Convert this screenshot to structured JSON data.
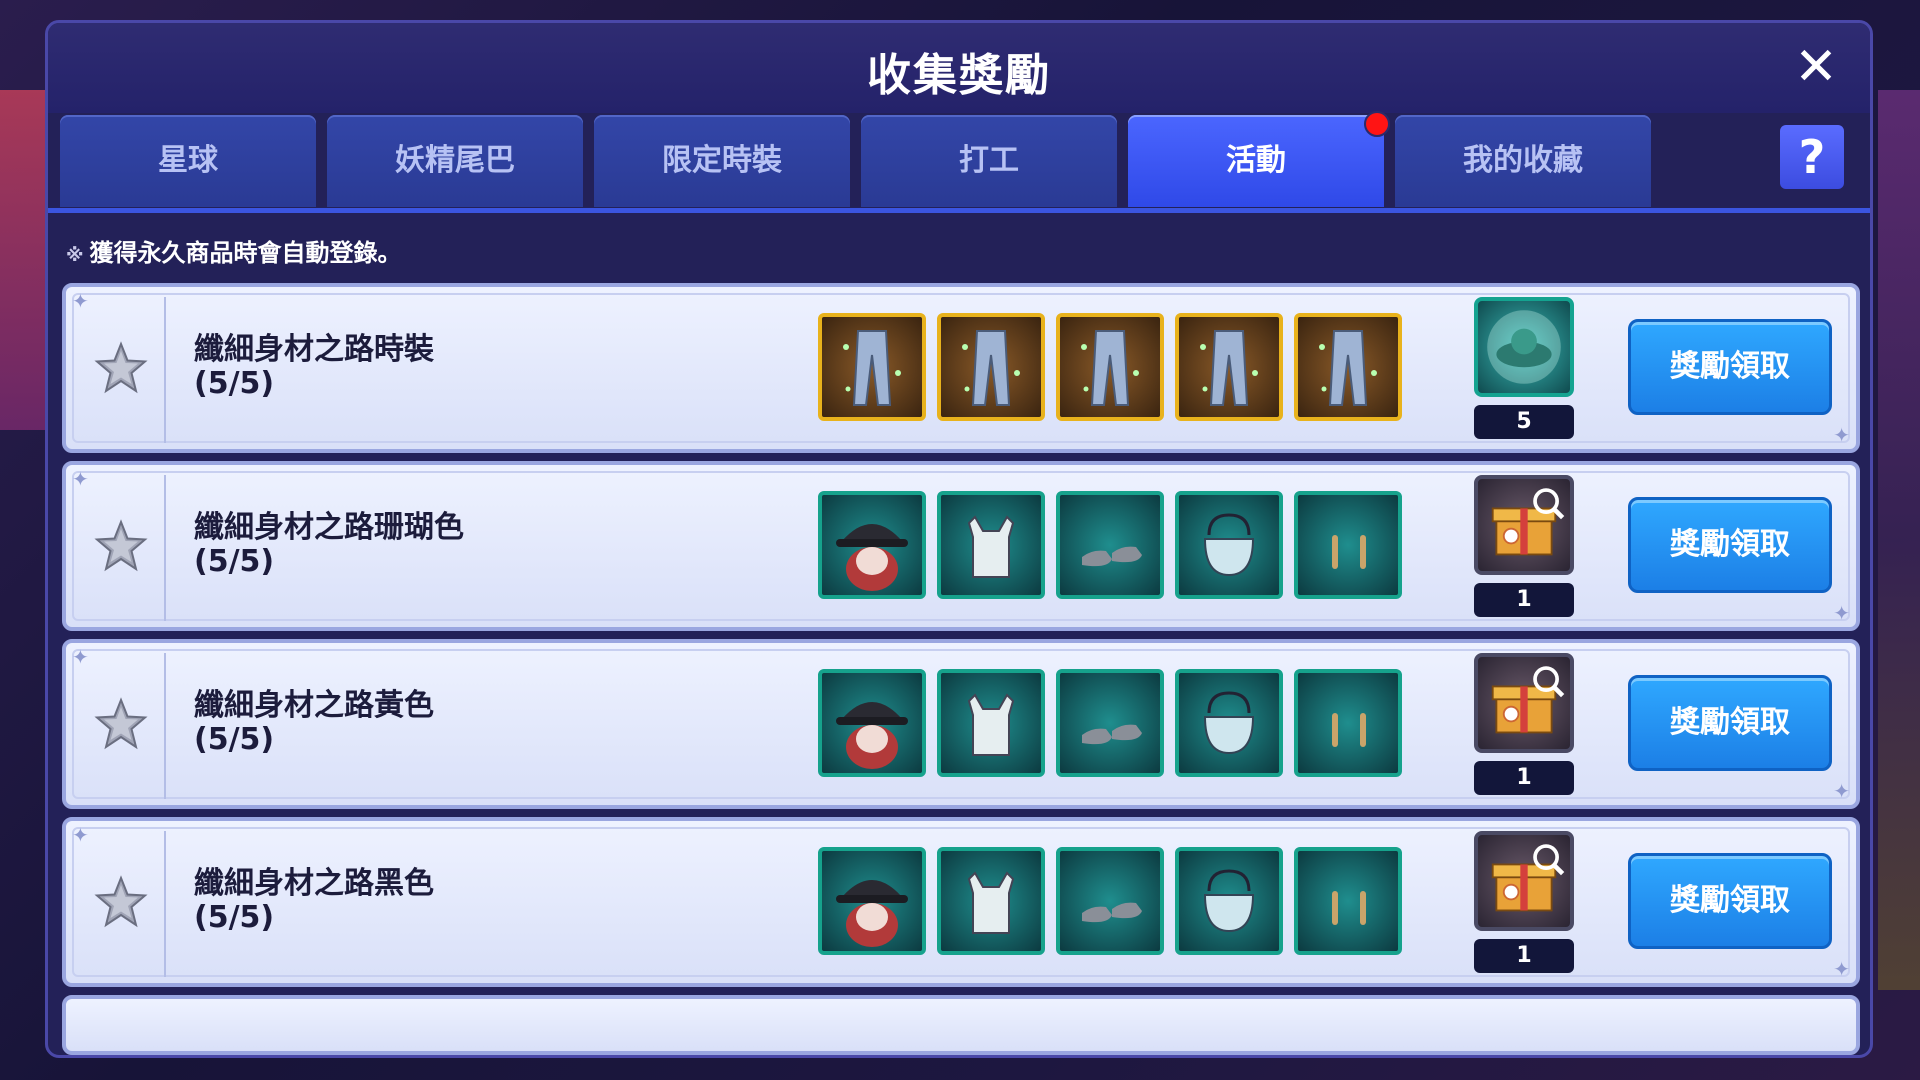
{
  "window": {
    "title": "收集獎勵",
    "close_label": "✕",
    "help_label": "?"
  },
  "tabs": [
    {
      "label": "星球",
      "active": false
    },
    {
      "label": "妖精尾巴",
      "active": false
    },
    {
      "label": "限定時裝",
      "active": false
    },
    {
      "label": "打工",
      "active": false
    },
    {
      "label": "活動",
      "active": true,
      "has_badge": true
    },
    {
      "label": "我的收藏",
      "active": false
    }
  ],
  "notice": {
    "mark": "※",
    "text": "獲得永久商品時會自動登錄。"
  },
  "colors": {
    "panel": "#232158",
    "tab": "#2a3a94",
    "tab_active": "#3b55ff",
    "claim": "#1c8cf0",
    "badge": "#ff1414",
    "row": "#e3e8fb",
    "gold_frame": "#e8b21c",
    "teal_frame": "#16a28c"
  },
  "rows": [
    {
      "name": "纖細身材之路時裝",
      "progress": "(5/5)",
      "item_style": "gold",
      "items": [
        "jeans-icon",
        "jeans-icon",
        "jeans-icon",
        "jeans-icon",
        "jeans-icon"
      ],
      "reward_icon": "planet-orb-icon",
      "reward_count": "5",
      "claim_label": "獎勵領取"
    },
    {
      "name": "纖細身材之路珊瑚色",
      "progress": "(5/5)",
      "item_style": "teal",
      "items": [
        "cap-icon",
        "tank-top-icon",
        "shoes-icon",
        "bag-icon",
        "earring-icon"
      ],
      "reward_icon": "gift-box-icon",
      "reward_count": "1",
      "claim_label": "獎勵領取"
    },
    {
      "name": "纖細身材之路黃色",
      "progress": "(5/5)",
      "item_style": "teal",
      "items": [
        "cap-icon",
        "tank-top-icon",
        "shoes-icon",
        "bag-icon",
        "earring-icon"
      ],
      "reward_icon": "gift-box-icon",
      "reward_count": "1",
      "claim_label": "獎勵領取"
    },
    {
      "name": "纖細身材之路黑色",
      "progress": "(5/5)",
      "item_style": "teal",
      "items": [
        "cap-icon",
        "tank-top-icon",
        "shoes-icon",
        "bag-icon",
        "earring-icon"
      ],
      "reward_icon": "gift-box-icon",
      "reward_count": "1",
      "claim_label": "獎勵領取"
    }
  ]
}
